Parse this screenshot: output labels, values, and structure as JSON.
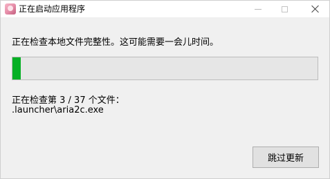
{
  "window": {
    "title": "正在启动应用程序",
    "icon": "app-avatar-icon"
  },
  "titlebar_controls": {
    "minimize_icon": "minimize-icon",
    "maximize_icon": "maximize-icon",
    "close_icon": "close-icon"
  },
  "main": {
    "message": "正在检查本地文件完整性。这可能需要一会儿时间。",
    "progress": {
      "fraction": 0.027,
      "fill_color": "#06b025"
    },
    "status_line": "正在检查第 3 / 37 个文件：",
    "current_file": ".launcher\\aria2c.exe"
  },
  "actions": {
    "skip_label": "跳过更新"
  }
}
